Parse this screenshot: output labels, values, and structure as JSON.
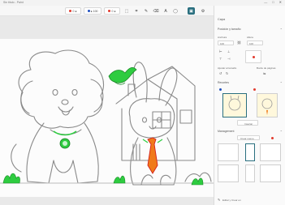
{
  "window": {
    "title": "Sin título - Paint",
    "minimize": "—",
    "maximize": "□",
    "close": "✕"
  },
  "toolbar": {
    "chip1": "0 ●",
    "chip2": "● 100",
    "chip3": "0 ●",
    "zoom": "1:1"
  },
  "panel": {
    "header": "Capa",
    "position_section": "Posición y tamaño",
    "width_label": "Anchura",
    "width_value": "100",
    "height_label": "Altura",
    "height_value": "100",
    "align_label": "Ajustar al tamaño",
    "adjust_label": "Ajustar",
    "outline_label": "Borde de páginas",
    "filters_section": "Recortes",
    "filter_action": "Insertar",
    "management_section": "Management",
    "management_button": "Crear nuevo",
    "footer_label": "Editar y Crear en"
  },
  "colors": {
    "accent": "#2a6f7f",
    "green": "#2ecc40",
    "red": "#e23b2e",
    "orange": "#f07a1a",
    "line": "#888888"
  }
}
